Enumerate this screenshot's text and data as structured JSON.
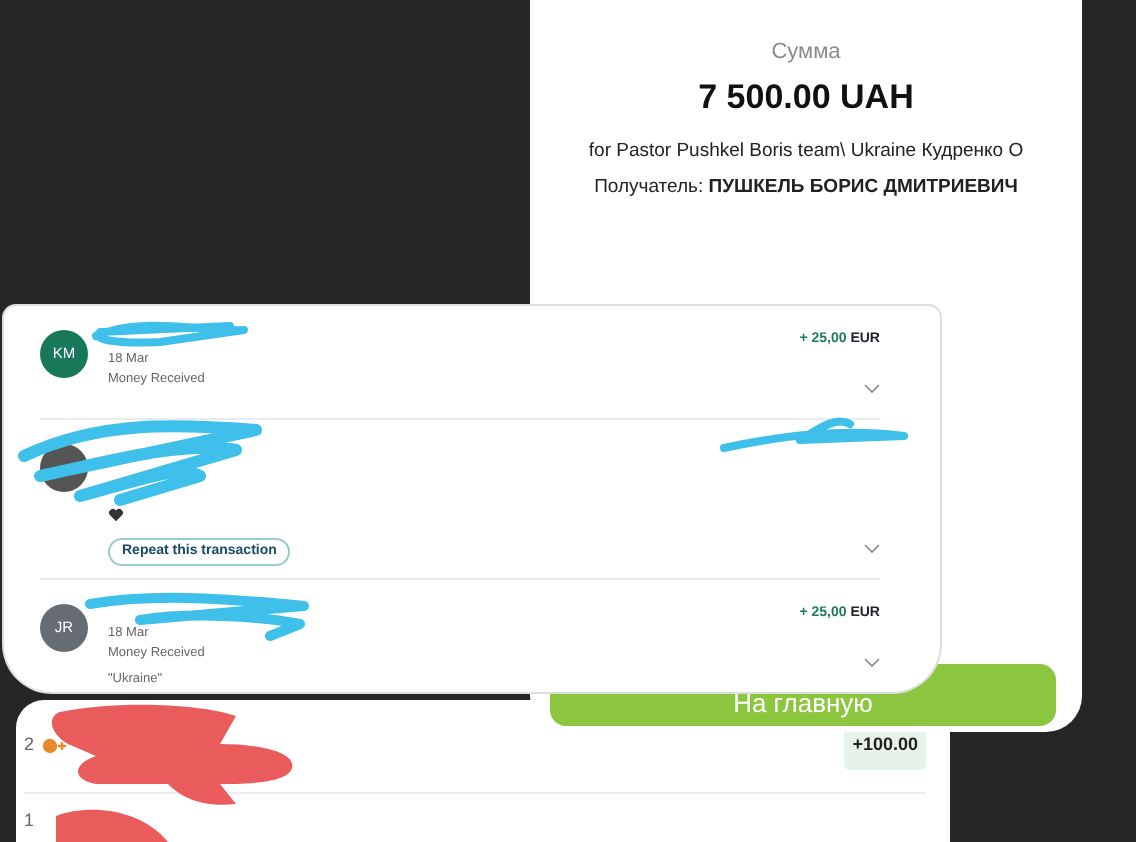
{
  "payment_panel": {
    "amount_label": "Сумма",
    "amount": "7 500.00 UAH",
    "purpose": "for Pastor Pushkel Boris team\\ Ukraine Кудренко О",
    "recipient": "Получатель: **ПУШКЕЛЬ БОРИС ДМИТРИЕВИЧ**",
    "home_button": "На главную"
  },
  "transactions": [
    {
      "kind": "initials",
      "initials": "KM",
      "color": "#17795a",
      "date": "18 Mar",
      "type": "Money Received",
      "amount": "+ 25,00",
      "currency": "EUR"
    },
    {
      "kind": "photo",
      "action": "Repeat this transaction"
    },
    {
      "kind": "initials",
      "initials": "JR",
      "color": "#656d72",
      "date": "18 Mar",
      "type": "Money Received",
      "note": "\"Ukraine\"",
      "amount": "+ 25,00",
      "currency": "EUR"
    }
  ],
  "bottom_list": {
    "rows": [
      {
        "index": "2",
        "amount": "+100.00"
      },
      {
        "index": "1"
      }
    ]
  }
}
